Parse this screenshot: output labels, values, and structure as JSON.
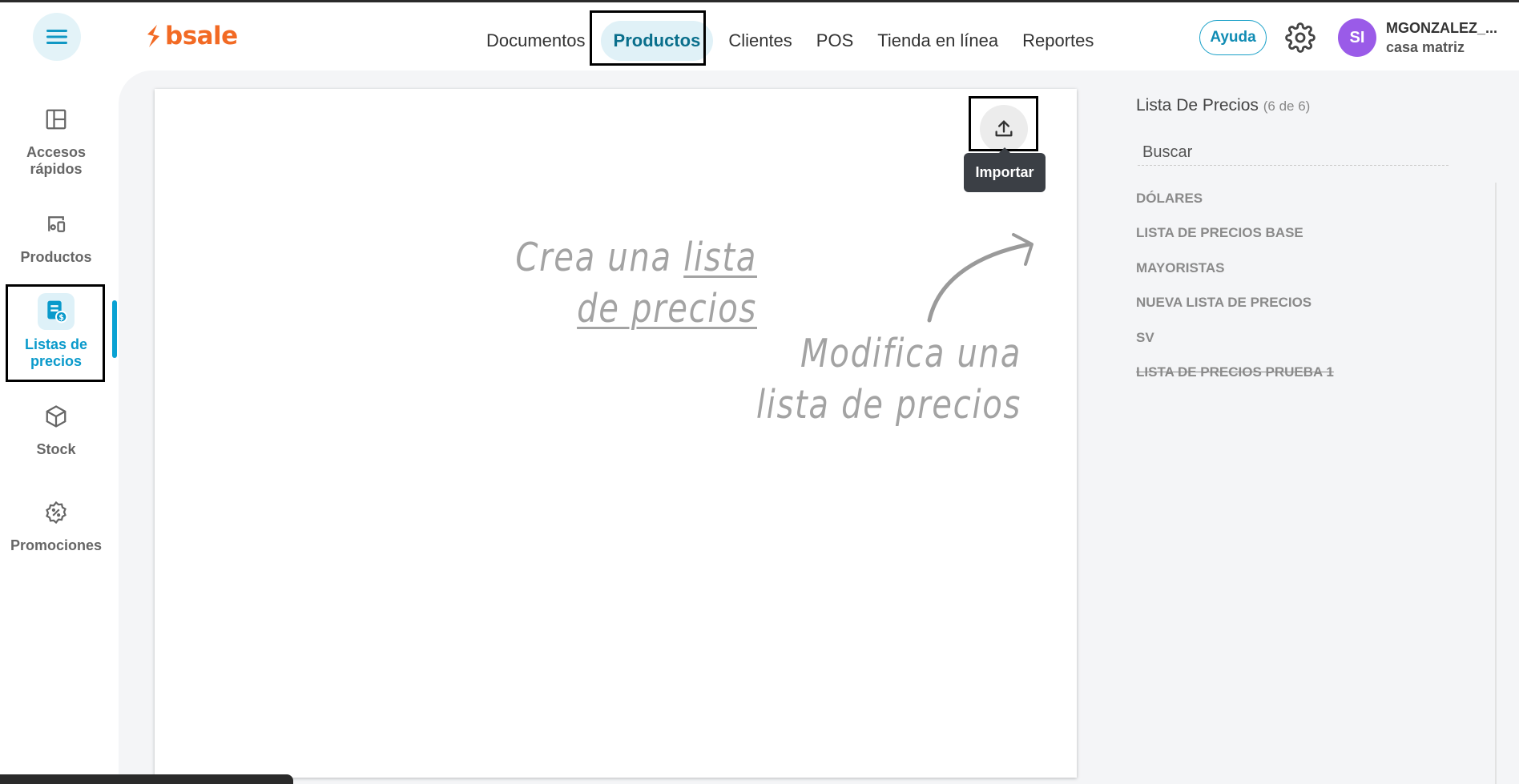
{
  "header": {
    "logo_text": "bsale",
    "nav": [
      {
        "label": "Documentos"
      },
      {
        "label": "Productos",
        "active": true
      },
      {
        "label": "Clientes"
      },
      {
        "label": "POS"
      },
      {
        "label": "Tienda en línea"
      },
      {
        "label": "Reportes"
      }
    ],
    "help_label": "Ayuda",
    "user": {
      "initials": "SI",
      "name": "MGONZALEZ_...",
      "branch": "casa matriz"
    }
  },
  "sidebar": {
    "items": [
      {
        "label": "Accesos rápidos",
        "icon": "layout-icon"
      },
      {
        "label": "Productos",
        "icon": "products-icon"
      },
      {
        "label": "Listas de precios",
        "icon": "price-list-icon",
        "active": true
      },
      {
        "label": "Stock",
        "icon": "box-icon"
      },
      {
        "label": "Promociones",
        "icon": "percent-badge-icon"
      }
    ]
  },
  "main": {
    "import_tooltip": "Importar",
    "create_line1_a": "Crea una ",
    "create_line1_b": "lista",
    "create_line2": "de precios",
    "modify_line1": "Modifica una",
    "modify_line2": "lista de precios"
  },
  "panel": {
    "title": "Lista De Precios",
    "count": "(6 de 6)",
    "search_placeholder": "Buscar",
    "lists": [
      {
        "name": "DÓLARES"
      },
      {
        "name": "LISTA DE PRECIOS BASE"
      },
      {
        "name": "MAYORISTAS"
      },
      {
        "name": "NUEVA LISTA DE PRECIOS"
      },
      {
        "name": "SV"
      },
      {
        "name": "LISTA DE PRECIOS PRUEBA 1",
        "disabled": true
      }
    ]
  },
  "colors": {
    "brand": "#f26a24",
    "accent": "#0a9acb",
    "avatar": "#9a5be8"
  }
}
